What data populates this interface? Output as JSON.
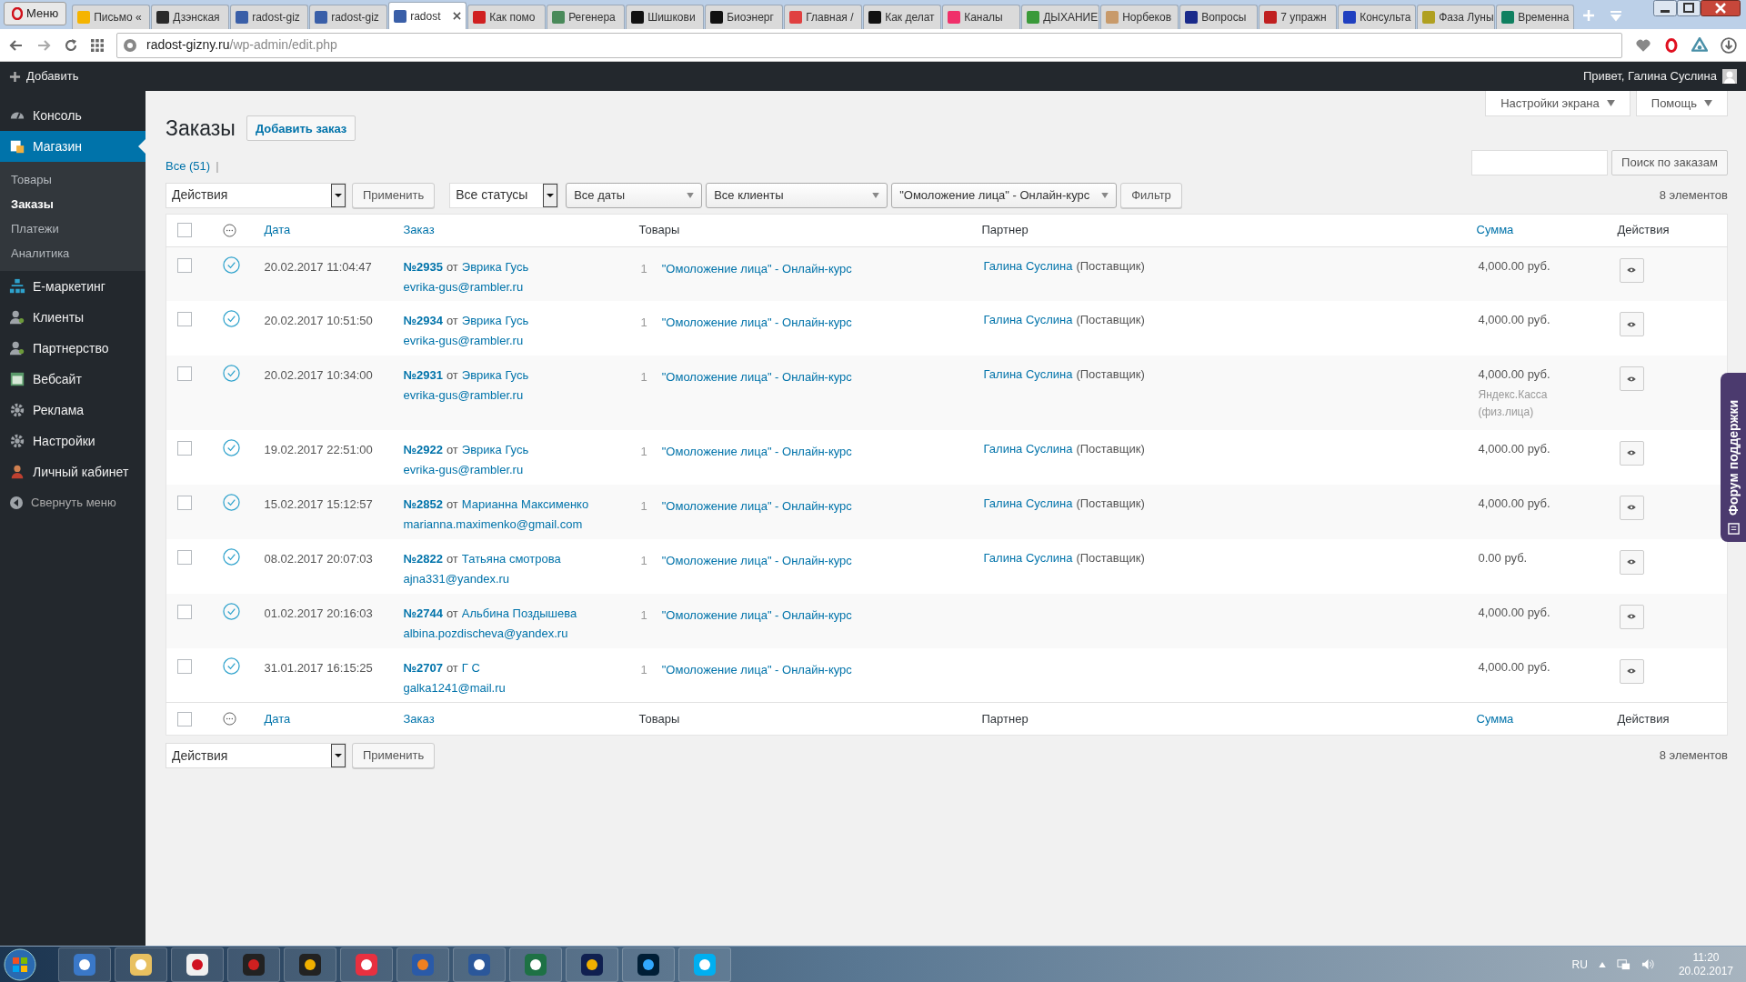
{
  "browser": {
    "menu_label": "Меню",
    "tabs": [
      {
        "label": "Письмо «",
        "selected": false,
        "color": "#f5b400"
      },
      {
        "label": "Дзэнская",
        "selected": false,
        "color": "#2a2a2a"
      },
      {
        "label": "radost-giz",
        "selected": false,
        "color": "#3a5fa8"
      },
      {
        "label": "radost-giz",
        "selected": false,
        "color": "#3a5fa8"
      },
      {
        "label": "radost",
        "selected": true,
        "color": "#3a5fa8"
      },
      {
        "label": "Как помо",
        "selected": false,
        "color": "#d02020"
      },
      {
        "label": "Регенера",
        "selected": false,
        "color": "#4a8a5a"
      },
      {
        "label": "Шишкови",
        "selected": false,
        "color": "#111111"
      },
      {
        "label": "Биоэнерг",
        "selected": false,
        "color": "#111111"
      },
      {
        "label": "Главная /",
        "selected": false,
        "color": "#e04040"
      },
      {
        "label": "Как делат",
        "selected": false,
        "color": "#111111"
      },
      {
        "label": "Каналы",
        "selected": false,
        "color": "#f0306a"
      },
      {
        "label": "ДЫХАНИЕ",
        "selected": false,
        "color": "#3a9a3a"
      },
      {
        "label": "Норбеков",
        "selected": false,
        "color": "#c89a6a"
      },
      {
        "label": "Вопросы",
        "selected": false,
        "color": "#1a2a8a"
      },
      {
        "label": "7 упражн",
        "selected": false,
        "color": "#c02020"
      },
      {
        "label": "Консульта",
        "selected": false,
        "color": "#2040c0"
      },
      {
        "label": "Фаза Луны",
        "selected": false,
        "color": "#b0a020"
      },
      {
        "label": "Временна",
        "selected": false,
        "color": "#108060"
      }
    ],
    "address": {
      "domain": "radost-gizny.ru",
      "path": "/wp-admin/edit.php"
    }
  },
  "admin_bar": {
    "add_label": "Добавить",
    "greeting": "Привет, Галина Суслина"
  },
  "sidebar": {
    "items": [
      {
        "label": "Консоль",
        "selected": false
      },
      {
        "label": "Магазин",
        "selected": true,
        "children": [
          {
            "label": "Товары",
            "selected": false
          },
          {
            "label": "Заказы",
            "selected": true
          },
          {
            "label": "Платежи",
            "selected": false
          },
          {
            "label": "Аналитика",
            "selected": false
          }
        ]
      },
      {
        "label": "Е-маркетинг",
        "selected": false
      },
      {
        "label": "Клиенты",
        "selected": false
      },
      {
        "label": "Партнерство",
        "selected": false
      },
      {
        "label": "Вебсайт",
        "selected": false
      },
      {
        "label": "Реклама",
        "selected": false
      },
      {
        "label": "Настройки",
        "selected": false
      },
      {
        "label": "Личный кабинет",
        "selected": false
      }
    ],
    "collapse_label": "Свернуть меню"
  },
  "screen_meta": [
    "Настройки экрана",
    "Помощь"
  ],
  "page_title": "Заказы",
  "add_button": "Добавить заказ",
  "views": {
    "label": "Все (51)",
    "separator": "|"
  },
  "search": {
    "button": "Поиск по заказам"
  },
  "top_filters": [
    {
      "kind": "native",
      "value": "Действия"
    },
    {
      "kind": "button",
      "value": "Применить"
    },
    {
      "kind": "native",
      "value": "Все статусы"
    },
    {
      "kind": "styled",
      "value": "Все даты"
    },
    {
      "kind": "styled",
      "value": "Все клиенты"
    },
    {
      "kind": "styled",
      "value": "\"Омоложение лица\" - Онлайн-курс"
    },
    {
      "kind": "button",
      "value": "Фильтр"
    }
  ],
  "top_count": "8 элементов",
  "table": {
    "header": [
      {
        "kind": "check",
        "checked": false
      },
      {
        "kind": "status"
      },
      {
        "kind": "text",
        "label": "Дата",
        "sortable": true
      },
      {
        "kind": "text",
        "label": "Заказ",
        "sortable": true
      },
      {
        "kind": "text",
        "label": "Товары",
        "sortable": false
      },
      {
        "kind": "text",
        "label": "Партнер",
        "sortable": false
      },
      {
        "kind": "text",
        "label": "Сумма",
        "sortable": true
      },
      {
        "kind": "text",
        "label": "Действия",
        "sortable": false
      }
    ],
    "rows": [
      {
        "checked": false,
        "date": "20.02.2017 11:04:47",
        "number": "№2935",
        "from": "от",
        "customer": "Эврика Гусь",
        "email": "evrika-gus@rambler.ru",
        "qty": "1",
        "product": "\"Омоложение лица\" - Онлайн-курс",
        "partner": "Галина Суслина",
        "partner_role": "(Поставщик)",
        "total": "4,000.00 руб."
      },
      {
        "checked": false,
        "date": "20.02.2017 10:51:50",
        "number": "№2934",
        "from": "от",
        "customer": "Эврика Гусь",
        "email": "evrika-gus@rambler.ru",
        "qty": "1",
        "product": "\"Омоложение лица\" - Онлайн-курс",
        "partner": "Галина Суслина",
        "partner_role": "(Поставщик)",
        "total": "4,000.00 руб."
      },
      {
        "checked": false,
        "date": "20.02.2017 10:34:00",
        "number": "№2931",
        "from": "от",
        "customer": "Эврика Гусь",
        "email": "evrika-gus@rambler.ru",
        "qty": "1",
        "product": "\"Омоложение лица\" - Онлайн-курс",
        "partner": "Галина Суслина",
        "partner_role": "(Поставщик)",
        "total": "4,000.00 руб.",
        "payment_note": "Яндекс.Касса (физ.лица)"
      },
      {
        "checked": false,
        "date": "19.02.2017 22:51:00",
        "number": "№2922",
        "from": "от",
        "customer": "Эврика Гусь",
        "email": "evrika-gus@rambler.ru",
        "qty": "1",
        "product": "\"Омоложение лица\" - Онлайн-курс",
        "partner": "Галина Суслина",
        "partner_role": "(Поставщик)",
        "total": "4,000.00 руб."
      },
      {
        "checked": false,
        "date": "15.02.2017 15:12:57",
        "number": "№2852",
        "from": "от",
        "customer": "Марианна Максименко",
        "email": "marianna.maximenko@gmail.com",
        "qty": "1",
        "product": "\"Омоложение лица\" - Онлайн-курс",
        "partner": "Галина Суслина",
        "partner_role": "(Поставщик)",
        "total": "4,000.00 руб."
      },
      {
        "checked": false,
        "date": "08.02.2017 20:07:03",
        "number": "№2822",
        "from": "от",
        "customer": "Татьяна смотрова",
        "email": "ajna331@yandex.ru",
        "qty": "1",
        "product": "\"Омоложение лица\" - Онлайн-курс",
        "partner": "Галина Суслина",
        "partner_role": "(Поставщик)",
        "total": "0.00 руб."
      },
      {
        "checked": false,
        "date": "01.02.2017 20:16:03",
        "number": "№2744",
        "from": "от",
        "customer": "Альбина Поздышева",
        "email": "albina.pozdischeva@yandex.ru",
        "qty": "1",
        "product": "\"Омоложение лица\" - Онлайн-курс",
        "total": "4,000.00 руб."
      },
      {
        "checked": false,
        "date": "31.01.2017 16:15:25",
        "number": "№2707",
        "from": "от",
        "customer": "Г С",
        "email": "galka1241@mail.ru",
        "qty": "1",
        "product": "\"Омоложение лица\" - Онлайн-курс",
        "total": "4,000.00 руб."
      }
    ],
    "footer": [
      {
        "kind": "check",
        "checked": false
      },
      {
        "kind": "status"
      },
      {
        "kind": "text",
        "label": "Дата",
        "sortable": true
      },
      {
        "kind": "text",
        "label": "Заказ",
        "sortable": true
      },
      {
        "kind": "text",
        "label": "Товары",
        "sortable": false
      },
      {
        "kind": "text",
        "label": "Партнер",
        "sortable": false
      },
      {
        "kind": "text",
        "label": "Сумма",
        "sortable": true
      },
      {
        "kind": "text",
        "label": "Действия",
        "sortable": false
      }
    ]
  },
  "bottom_filters": [
    {
      "kind": "native",
      "value": "Действия"
    },
    {
      "kind": "button",
      "value": "Применить"
    }
  ],
  "bottom_count": "8 элементов",
  "support_tab": "Форум поддержки",
  "taskbar": {
    "language": "RU",
    "time": "11:20",
    "date": "20.02.2017"
  }
}
